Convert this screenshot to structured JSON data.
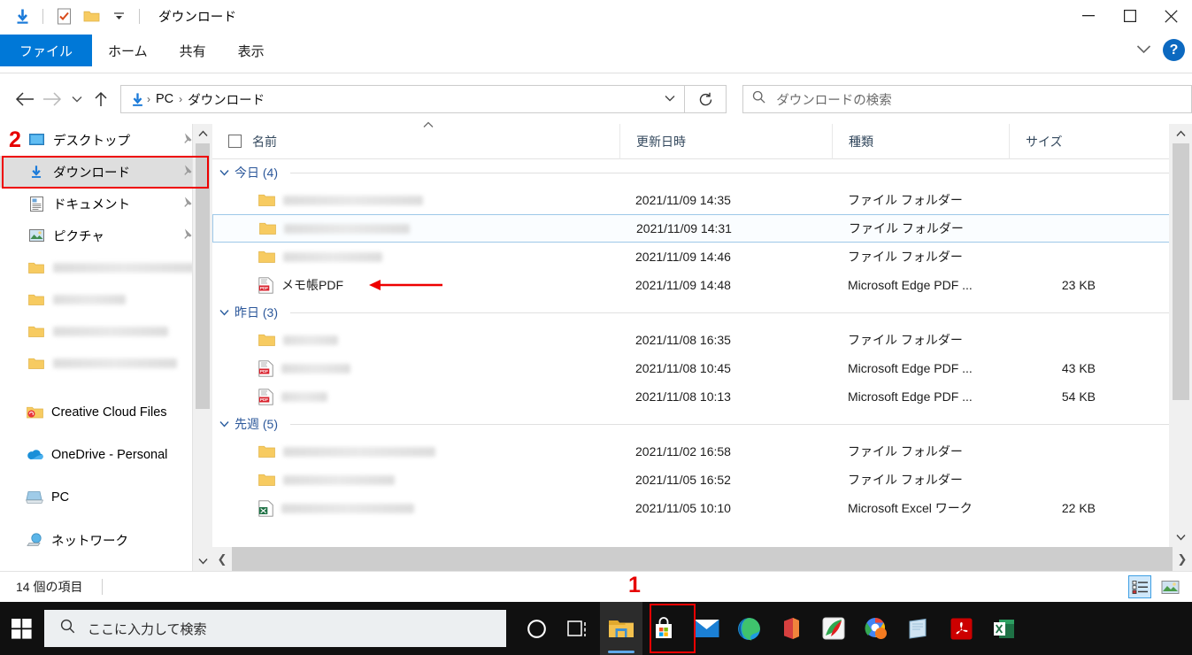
{
  "window": {
    "title": "ダウンロード",
    "quick_access_icons": [
      "download-arrow-icon",
      "checkbox-properties-icon",
      "new-folder-icon",
      "customize-dropdown-icon"
    ],
    "controls": {
      "minimize": "—",
      "maximize": "☐",
      "close": "✕"
    }
  },
  "ribbon": {
    "tabs": [
      {
        "label": "ファイル",
        "active": true
      },
      {
        "label": "ホーム",
        "active": false
      },
      {
        "label": "共有",
        "active": false
      },
      {
        "label": "表示",
        "active": false
      }
    ],
    "collapse_icon": "chevron-down-icon",
    "help_label": "?"
  },
  "address": {
    "back_icon": "back-arrow-icon",
    "forward_icon": "forward-arrow-icon",
    "recent_icon": "recent-locations-icon",
    "up_icon": "up-arrow-icon",
    "breadcrumb": [
      "PC",
      "ダウンロード"
    ],
    "breadcrumb_separator": "›",
    "dropdown_icon": "chevron-down-icon",
    "refresh_icon": "refresh-icon"
  },
  "search": {
    "icon": "search-icon",
    "placeholder": "ダウンロードの検索"
  },
  "sidebar": {
    "items": [
      {
        "label": "デスクトップ",
        "icon": "desktop-icon",
        "pinned": true,
        "selected": false,
        "blurred": false
      },
      {
        "label": "ダウンロード",
        "icon": "download-arrow-icon",
        "pinned": true,
        "selected": true,
        "blurred": false
      },
      {
        "label": "ドキュメント",
        "icon": "documents-icon",
        "pinned": true,
        "selected": false,
        "blurred": false
      },
      {
        "label": "ピクチャ",
        "icon": "pictures-icon",
        "pinned": true,
        "selected": false,
        "blurred": false
      },
      {
        "label": "",
        "icon": "folder-icon",
        "pinned": false,
        "selected": false,
        "blurred": true,
        "blur_width": 160
      },
      {
        "label": "",
        "icon": "folder-icon",
        "pinned": false,
        "selected": false,
        "blurred": true,
        "blur_width": 82
      },
      {
        "label": "",
        "icon": "folder-icon",
        "pinned": false,
        "selected": false,
        "blurred": true,
        "blur_width": 130
      },
      {
        "label": "",
        "icon": "folder-icon",
        "pinned": false,
        "selected": false,
        "blurred": true,
        "blur_width": 140
      },
      {
        "label": "Creative Cloud Files",
        "icon": "creative-cloud-icon",
        "pinned": false,
        "selected": false,
        "blurred": false
      },
      {
        "label": "OneDrive - Personal",
        "icon": "onedrive-icon",
        "pinned": false,
        "selected": false,
        "blurred": false
      },
      {
        "label": "PC",
        "icon": "pc-icon",
        "pinned": false,
        "selected": false,
        "blurred": false
      },
      {
        "label": "ネットワーク",
        "icon": "network-icon",
        "pinned": false,
        "selected": false,
        "blurred": false
      }
    ]
  },
  "columns": {
    "name": "名前",
    "date": "更新日時",
    "type": "種類",
    "size": "サイズ",
    "sort_indicator": "ascending"
  },
  "groups": [
    {
      "label": "今日 (4)",
      "rows": [
        {
          "name": "",
          "blurred": true,
          "blur_width": 158,
          "icon": "folder-icon",
          "date": "2021/11/09 14:35",
          "type": "ファイル フォルダー",
          "size": "",
          "selected": false
        },
        {
          "name": "",
          "blurred": true,
          "blur_width": 142,
          "icon": "folder-icon",
          "date": "2021/11/09 14:31",
          "type": "ファイル フォルダー",
          "size": "",
          "selected": true
        },
        {
          "name": "",
          "blurred": true,
          "blur_width": 112,
          "icon": "folder-icon",
          "date": "2021/11/09 14:46",
          "type": "ファイル フォルダー",
          "size": "",
          "selected": false
        },
        {
          "name": "メモ帳PDF",
          "blurred": false,
          "icon": "pdf-icon",
          "date": "2021/11/09 14:48",
          "type": "Microsoft Edge PDF ...",
          "size": "23 KB",
          "selected": false,
          "annotated": true
        }
      ]
    },
    {
      "label": "昨日 (3)",
      "rows": [
        {
          "name": "",
          "blurred": true,
          "blur_width": 62,
          "icon": "folder-icon",
          "date": "2021/11/08 16:35",
          "type": "ファイル フォルダー",
          "size": "",
          "selected": false
        },
        {
          "name": "",
          "blurred": true,
          "blur_width": 78,
          "icon": "pdf-icon",
          "date": "2021/11/08 10:45",
          "type": "Microsoft Edge PDF ...",
          "size": "43 KB",
          "selected": false
        },
        {
          "name": "",
          "blurred": true,
          "blur_width": 52,
          "icon": "pdf-icon",
          "date": "2021/11/08 10:13",
          "type": "Microsoft Edge PDF ...",
          "size": "54 KB",
          "selected": false
        }
      ]
    },
    {
      "label": "先週 (5)",
      "rows": [
        {
          "name": "",
          "blurred": true,
          "blur_width": 172,
          "icon": "folder-icon",
          "date": "2021/11/02 16:58",
          "type": "ファイル フォルダー",
          "size": "",
          "selected": false
        },
        {
          "name": "",
          "blurred": true,
          "blur_width": 126,
          "icon": "folder-icon",
          "date": "2021/11/05 16:52",
          "type": "ファイル フォルダー",
          "size": "",
          "selected": false
        },
        {
          "name": "",
          "blurred": true,
          "blur_width": 150,
          "icon": "excel-icon",
          "date": "2021/11/05 10:10",
          "type": "Microsoft Excel ワーク",
          "size": "22 KB",
          "selected": false
        }
      ]
    }
  ],
  "status": {
    "item_count": "14 個の項目",
    "details_view_icon": "details-view-icon",
    "large_icons_view_icon": "large-icons-view-icon"
  },
  "taskbar": {
    "start_icon": "windows-start-icon",
    "search_icon": "search-icon",
    "search_placeholder": "ここに入力して検索",
    "icons": [
      {
        "name": "cortana-icon",
        "active": false
      },
      {
        "name": "task-view-icon",
        "active": false
      },
      {
        "name": "file-explorer-icon",
        "active": true
      },
      {
        "name": "microsoft-store-icon",
        "active": false
      },
      {
        "name": "mail-icon",
        "active": false
      },
      {
        "name": "microsoft-edge-icon",
        "active": false
      },
      {
        "name": "microsoft-office-icon",
        "active": false
      },
      {
        "name": "colorful-app-icon",
        "active": false
      },
      {
        "name": "google-chrome-icon",
        "active": false
      },
      {
        "name": "sticky-notes-icon",
        "active": false
      },
      {
        "name": "adobe-acrobat-icon",
        "active": false
      },
      {
        "name": "microsoft-excel-icon",
        "active": false
      }
    ]
  },
  "annotations": {
    "marker_1": "1",
    "marker_2": "2",
    "accent_red": "#ee0000"
  }
}
